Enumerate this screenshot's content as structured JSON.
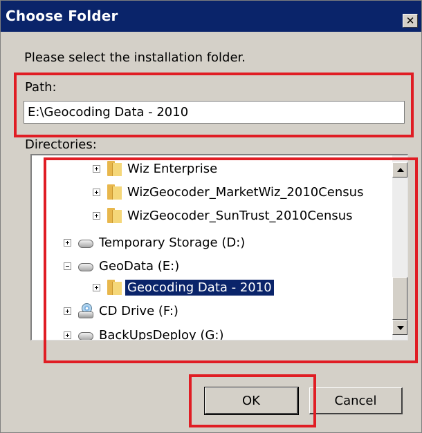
{
  "window": {
    "title": "Choose Folder"
  },
  "instruction": "Please select the installation folder.",
  "path": {
    "label": "Path:",
    "value": "E:\\Geocoding Data - 2010"
  },
  "directories": {
    "label": "Directories:",
    "items": [
      {
        "label": "Wiz Enterprise",
        "icon": "folder-icon",
        "expander": "plus"
      },
      {
        "label": "WizGeocoder_MarketWiz_2010Census",
        "icon": "folder-icon",
        "expander": "plus"
      },
      {
        "label": "WizGeocoder_SunTrust_2010Census",
        "icon": "folder-icon",
        "expander": "plus"
      },
      {
        "label": "Temporary Storage (D:)",
        "icon": "hard-drive-icon",
        "expander": "plus"
      },
      {
        "label": "GeoData (E:)",
        "icon": "hard-drive-icon",
        "expander": "minus"
      },
      {
        "label": "Geocoding Data - 2010",
        "icon": "folder-icon",
        "expander": "plus",
        "selected": true
      },
      {
        "label": "CD Drive (F:)",
        "icon": "cd-drive-icon",
        "expander": "plus"
      },
      {
        "label": "BackUpsDeploy (G:)",
        "icon": "hard-drive-icon",
        "expander": "plus"
      }
    ]
  },
  "buttons": {
    "ok": "OK",
    "cancel": "Cancel",
    "close": "✕"
  },
  "colors": {
    "titlebar": "#0a246a",
    "highlight": "#e01d24",
    "selection": "#0a246a"
  }
}
